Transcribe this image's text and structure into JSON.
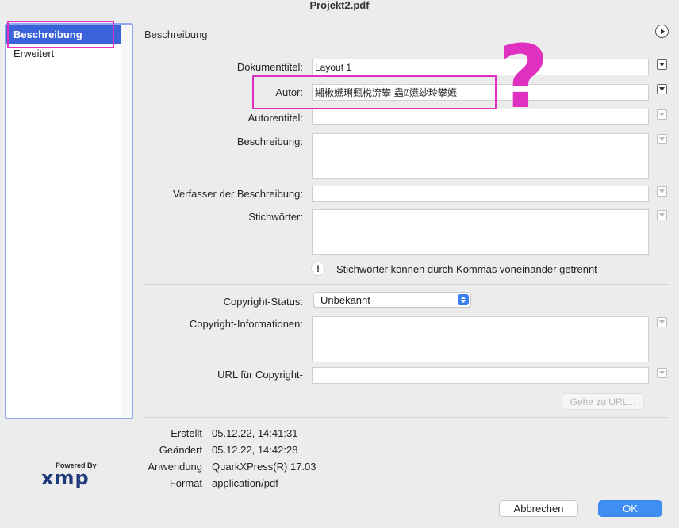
{
  "window": {
    "title": "Projekt2.pdf"
  },
  "sidebar": {
    "items": [
      {
        "label": "Beschreibung",
        "selected": true
      },
      {
        "label": "Erweitert",
        "selected": false
      }
    ]
  },
  "main": {
    "section_title": "Beschreibung",
    "fields": {
      "document_title": {
        "label": "Dokumenttitel:",
        "value": "Layout 1"
      },
      "author": {
        "label": "Autor:",
        "value": "緗楸嬿琍甀梲渀攀 蟲⍰嬿玅玲攀嬿"
      },
      "author_title": {
        "label": "Autorentitel:",
        "value": ""
      },
      "description": {
        "label": "Beschreibung:",
        "value": ""
      },
      "description_writer": {
        "label": "Verfasser der Beschreibung:",
        "value": ""
      },
      "keywords": {
        "label": "Stichwörter:",
        "value": ""
      },
      "keywords_hint": "Stichwörter können durch Kommas voneinander getrennt",
      "copyright_status": {
        "label": "Copyright-Status:",
        "value": "Unbekannt"
      },
      "copyright_info": {
        "label": "Copyright-Informationen:",
        "value": ""
      },
      "copyright_url": {
        "label": "URL für Copyright-",
        "value": ""
      }
    },
    "goto_url_button": "Gehe zu URL...",
    "hint_glyph": "!",
    "annotation_glyph": "?"
  },
  "info": {
    "created": {
      "label": "Erstellt",
      "value": "05.12.22, 14:41:31"
    },
    "modified": {
      "label": "Geändert",
      "value": "05.12.22, 14:42:28"
    },
    "application": {
      "label": "Anwendung",
      "value": "QuarkXPress(R) 17.03"
    },
    "format": {
      "label": "Format",
      "value": "application/pdf"
    }
  },
  "logo": {
    "top_text": "Powered By",
    "brand": "xmp"
  },
  "buttons": {
    "cancel": "Abbrechen",
    "ok": "OK"
  },
  "colors": {
    "accent": "#3b63d9",
    "annotation": "#e030c0",
    "primary_button": "#3f8ef3"
  }
}
